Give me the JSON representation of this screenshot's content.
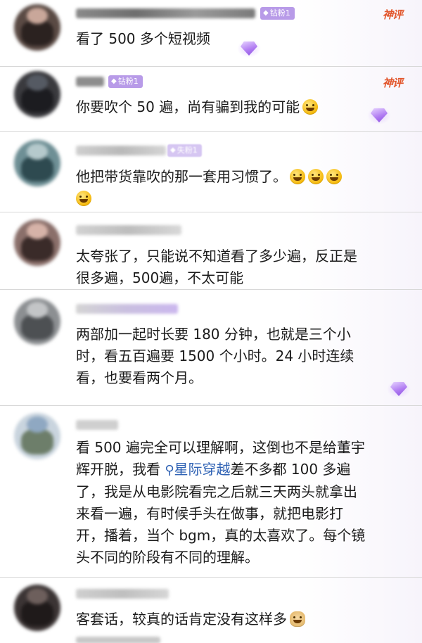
{
  "colors": {
    "badge_bg": "#b89be8",
    "shenping": "#e2562c",
    "link": "#2f62b4",
    "divider": "#d8d8d8"
  },
  "comments": [
    {
      "badge": "钻粉1",
      "shenping": "神评",
      "text": "看了 500 多个短视频",
      "gem": "purple-diamond-icon"
    },
    {
      "badge": "钻粉1",
      "shenping": "神评",
      "text": "你要吹个 50 遍，尚有骗到我的可能",
      "emoji": "smile-emoji",
      "gem": "purple-diamond-icon"
    },
    {
      "badge": "失粉1",
      "text": "他把带货靠吹的那一套用习惯了。",
      "emojis": [
        "laugh-cry-emoji",
        "laugh-emoji",
        "grin-emoji",
        "laugh-cry-emoji"
      ]
    },
    {
      "text_lines": [
        "太夸张了，只能说不知道看了多少遍，反正是",
        "很多遍，500遍，不太可能"
      ]
    },
    {
      "text_lines": [
        "两部加一起时长要 180 分钟，也就是三个小",
        "时，看五百遍要 1500 个小时。24 小时连续",
        "看，也要看两个月。"
      ],
      "gem": "purple-diamond-icon"
    },
    {
      "line1": "看 500 遍完全可以理解啊，这倒也不是给董宇",
      "line2_pre": "辉开脱，我看 ",
      "link_icon": "search-icon",
      "link_text": "星际穿越",
      "line2_post": "差不多都 100 多遍",
      "rest_lines": [
        "了，我是从电影院看完之后就三天两头就拿出",
        "来看一遍，有时候手头在做事，就把电影打",
        "开，播着，当个 bgm，真的太喜欢了。每个镜",
        "头不同的阶段有不同的理解。"
      ]
    },
    {
      "text": "客套话，较真的话肯定没有这样多",
      "emoji": "doge-emoji"
    }
  ]
}
